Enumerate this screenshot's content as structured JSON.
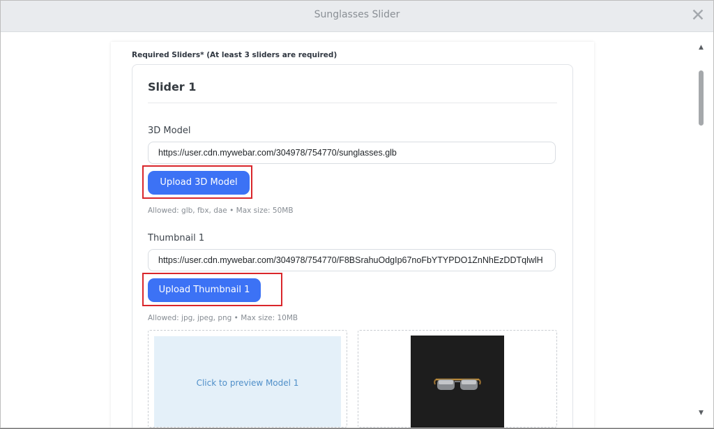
{
  "window": {
    "title": "Sunglasses Slider",
    "close_icon": "close-icon"
  },
  "form": {
    "required_note": "Required Sliders* (At least 3 sliders are required)",
    "slider": {
      "title": "Slider 1",
      "model_label": "3D Model",
      "model_url": "https://user.cdn.mywebar.com/304978/754770/sunglasses.glb",
      "upload_model_label": "Upload 3D Model",
      "model_hint": "Allowed: glb, fbx, dae • Max size: 50MB",
      "thumbnail_label": "Thumbnail 1",
      "thumbnail_url": "https://user.cdn.mywebar.com/304978/754770/F8BSrahuOdgIp67noFbYTYPDO1ZnNhEzDDTqlwlH",
      "upload_thumbnail_label": "Upload Thumbnail 1",
      "thumbnail_hint": "Allowed: jpg, jpeg, png • Max size: 10MB",
      "preview_text": "Click to preview Model 1"
    }
  },
  "colors": {
    "accent_button": "#3c72f5",
    "highlight_border": "#d9262b",
    "preview_bg": "#e4f0f9",
    "thumbnail_bg": "#1d1d1d"
  }
}
